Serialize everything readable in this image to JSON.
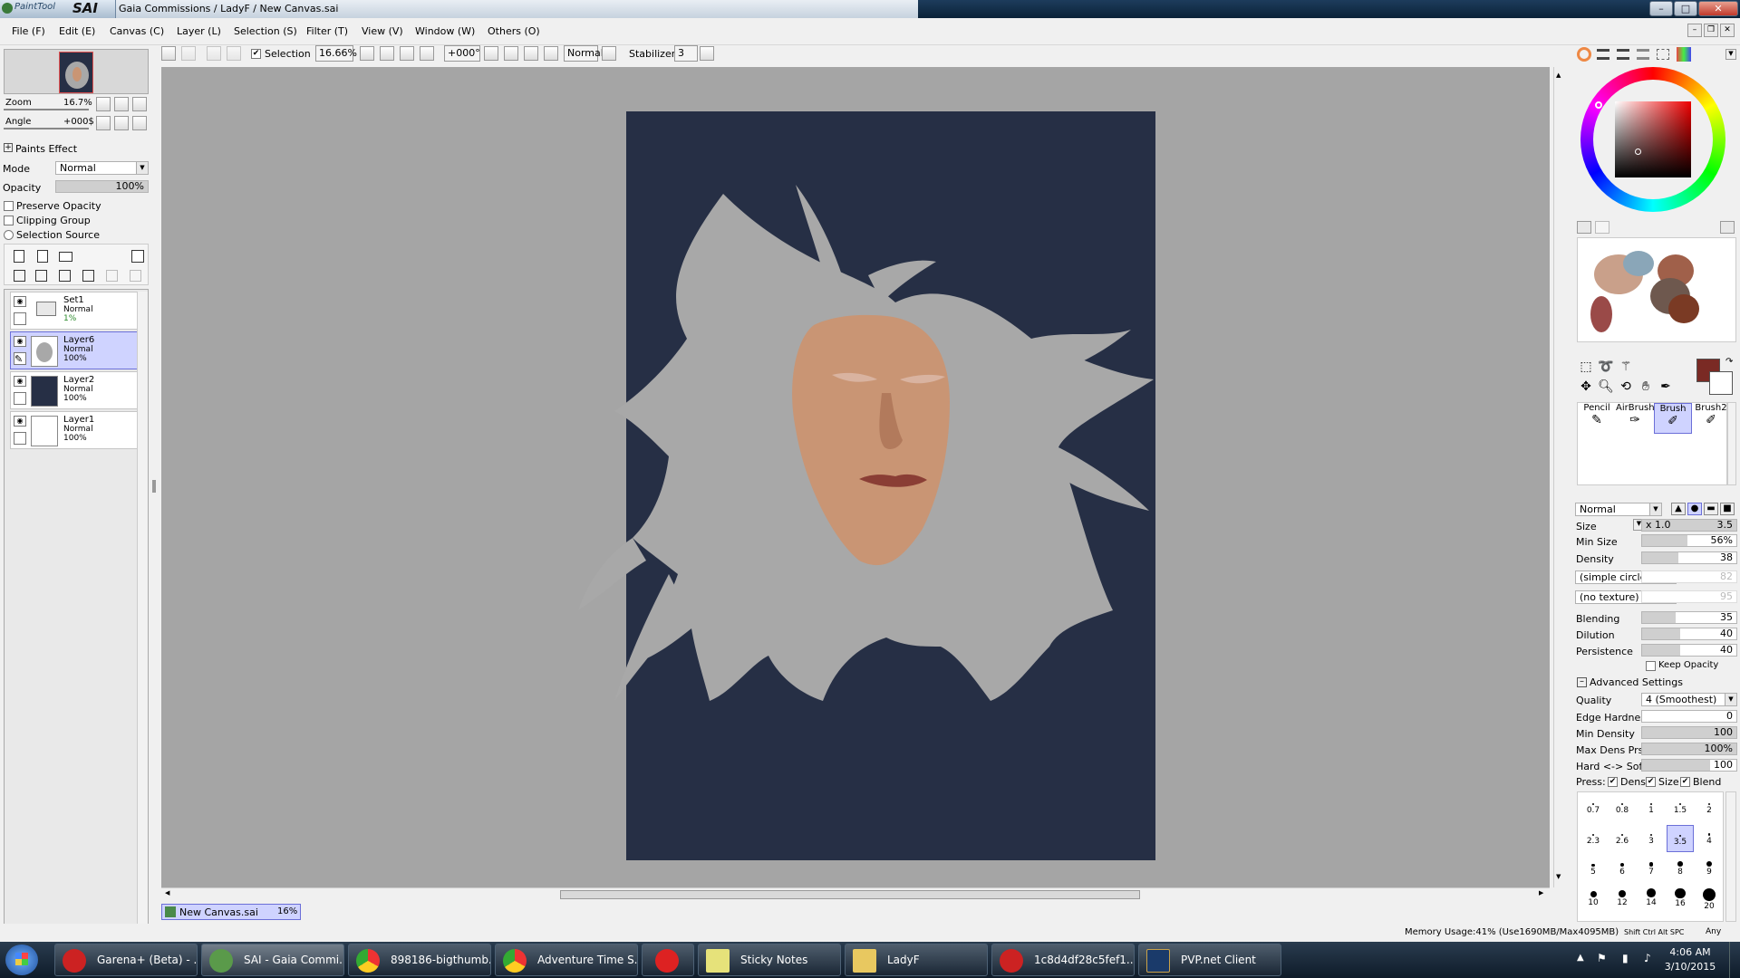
{
  "window": {
    "logo_small": "PaintTool",
    "logo_big": "SAI",
    "title": "Gaia Commissions / LadyF / New Canvas.sai"
  },
  "menu": [
    "File (F)",
    "Edit (E)",
    "Canvas (C)",
    "Layer (L)",
    "Selection (S)",
    "Filter (T)",
    "View (V)",
    "Window (W)",
    "Others (O)"
  ],
  "toolbar": {
    "selection_label": "Selection",
    "selection_checked": true,
    "zoom": "16.66%",
    "angle": "+000°",
    "blend_mode": "Normal",
    "stabilizer_label": "Stabilizer",
    "stabilizer_value": "3"
  },
  "navigator": {
    "zoom_label": "Zoom",
    "zoom_value": "16.7%",
    "angle_label": "Angle",
    "angle_value": "+000$"
  },
  "layer_panel": {
    "paints_effect": "Paints Effect",
    "mode_label": "Mode",
    "mode_value": "Normal",
    "opacity_label": "Opacity",
    "opacity_value": "100%",
    "preserve_opacity": "Preserve Opacity",
    "clipping_group": "Clipping Group",
    "selection_source": "Selection Source",
    "layers": [
      {
        "name": "Set1",
        "mode": "Normal",
        "opacity": "1%",
        "type": "folder"
      },
      {
        "name": "Layer6",
        "mode": "Normal",
        "opacity": "100%",
        "selected": true
      },
      {
        "name": "Layer2",
        "mode": "Normal",
        "opacity": "100%"
      },
      {
        "name": "Layer1",
        "mode": "Normal",
        "opacity": "100%"
      }
    ]
  },
  "colors": {
    "canvas_bg": "#262f45",
    "hair": "#a8a8a8",
    "skin": "#c99574",
    "primary_color": "#7a2a24"
  },
  "document_tab": {
    "name": "New Canvas.sai",
    "zoom": "16%"
  },
  "tools": {
    "brush_types": [
      "Pencil",
      "AirBrush",
      "Brush",
      "Brush2"
    ],
    "selected_brush": "Brush",
    "blend_mode": "Normal",
    "size_label": "Size",
    "size_mult": "x 1.0",
    "size_value": "3.5",
    "min_size_label": "Min Size",
    "min_size_value": "56%",
    "min_size_level": 0.56,
    "density_label": "Density",
    "density_value": "38",
    "shape": "(simple circle)",
    "shape_amount": "82",
    "texture": "(no texture)",
    "texture_amount": "95",
    "blending_label": "Blending",
    "blending_value": "35",
    "dilution_label": "Dilution",
    "dilution_value": "40",
    "persistence_label": "Persistence",
    "persistence_value": "40",
    "keep_opacity": "Keep Opacity",
    "advanced_settings": "Advanced Settings",
    "quality_label": "Quality",
    "quality_value": "4 (Smoothest)",
    "edge_hardness_label": "Edge Hardness",
    "edge_hardness_value": "0",
    "min_density_label": "Min Density",
    "min_density_value": "100",
    "max_dens_label": "Max Dens Prs.",
    "max_dens_value": "100%",
    "hard_soft_label": "Hard <-> Soft",
    "hard_soft_value": "100",
    "press_label": "Press:",
    "press_dens": "Dens",
    "press_size": "Size",
    "press_blend": "Blend",
    "brush_sizes": [
      "0.7",
      "0.8",
      "1",
      "1.5",
      "2",
      "2.3",
      "2.6",
      "3",
      "3.5",
      "4",
      "5",
      "6",
      "7",
      "8",
      "9",
      "10",
      "12",
      "14",
      "16",
      "20"
    ],
    "selected_size": "3.5"
  },
  "status": {
    "memory": "Memory Usage:41% (Use1690MB/Max4095MB)",
    "keys": "Shift Ctrl Alt SPC",
    "any": "Any"
  },
  "taskbar": {
    "items": [
      "Garena+ (Beta) - ...",
      "SAI - Gaia Commi...",
      "898186-bigthumb...",
      "Adventure Time S...",
      "",
      "Sticky Notes",
      "LadyF",
      "1c8d4df28c5fef1...",
      "PVP.net Client"
    ],
    "time": "4:06 AM",
    "date": "3/10/2015"
  }
}
